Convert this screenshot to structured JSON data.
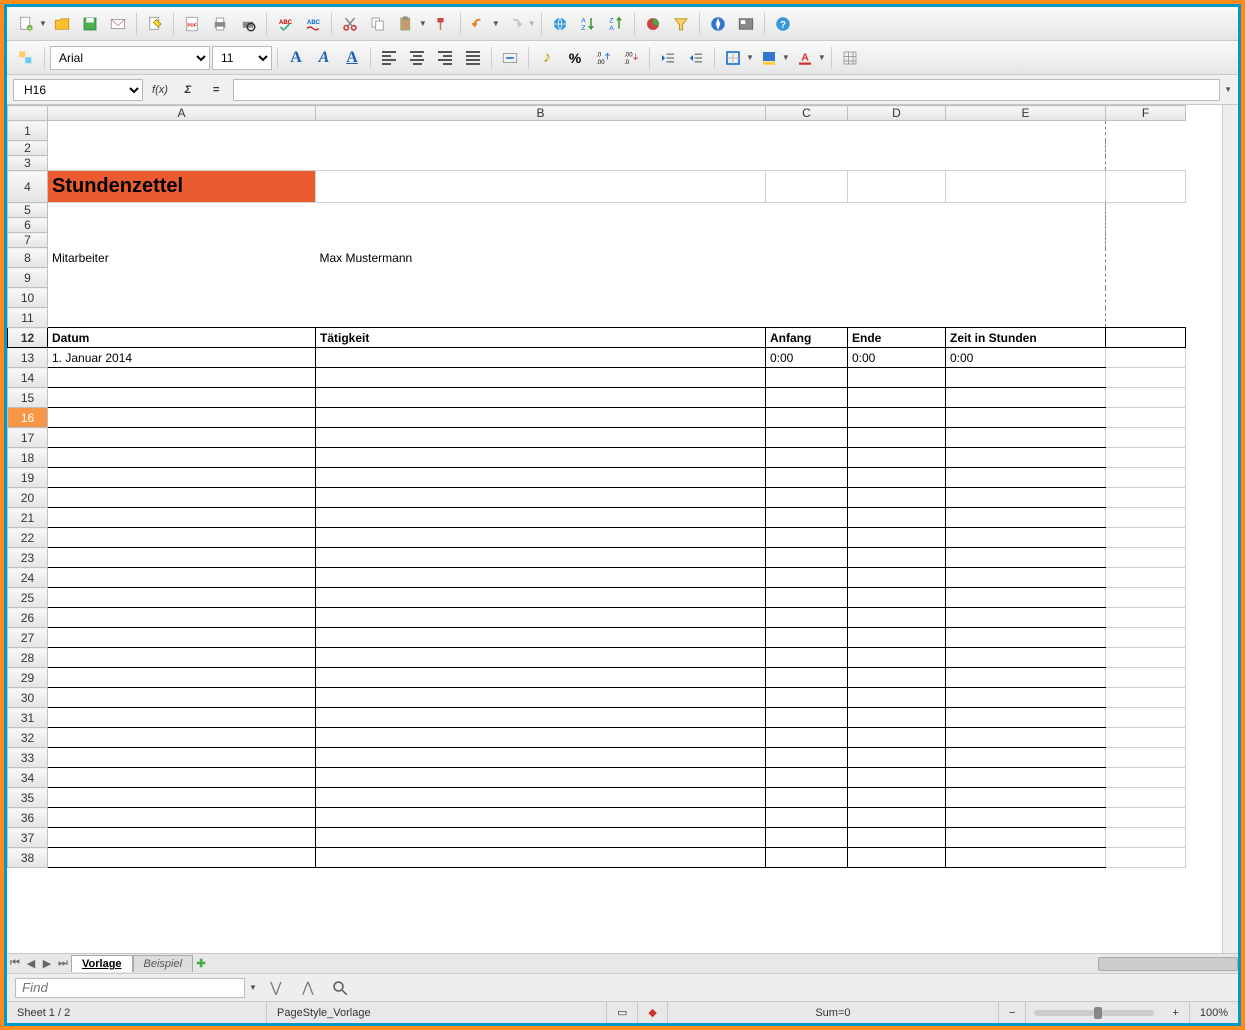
{
  "toolbar1": {
    "icons": [
      "new-document",
      "open-document",
      "save-document",
      "email-document",
      "edit-document",
      "pdf-export",
      "print",
      "print-preview",
      "spellcheck",
      "autospellcheck",
      "cut",
      "copy",
      "paste",
      "format-paintbrush",
      "undo",
      "redo",
      "hyperlink",
      "sort-asc",
      "sort-desc",
      "chart-insert",
      "filter",
      "navigator",
      "gallery",
      "help"
    ]
  },
  "toolbar2": {
    "styles_icon": "styles-icon",
    "font_name": "Arial",
    "font_size": "11",
    "bold": "A",
    "italic": "A",
    "underline": "A",
    "merge_label": "⬍",
    "currency": "%",
    "number_fmt": ".0"
  },
  "formula_bar": {
    "cell_ref": "H16",
    "fx": "f(x)",
    "sigma": "Σ",
    "eq": "=",
    "value": ""
  },
  "columns": [
    "A",
    "B",
    "C",
    "D",
    "E",
    "F"
  ],
  "sheet": {
    "title": "Stundenzettel",
    "employee_label": "Mitarbeiter",
    "employee_name": "Max Mustermann",
    "headers": [
      "Datum",
      "Tätigkeit",
      "Anfang",
      "Ende",
      "Zeit in Stunden"
    ],
    "first_row": [
      "1. Januar 2014",
      "",
      "0:00",
      "0:00",
      "0:00"
    ]
  },
  "row_nums": [
    1,
    2,
    3,
    4,
    5,
    6,
    7,
    8,
    9,
    10,
    11,
    12,
    13,
    14,
    15,
    16,
    17,
    18,
    19,
    20,
    21,
    22,
    23,
    24,
    25,
    26,
    27,
    28,
    29,
    30,
    31,
    32,
    33,
    34,
    35,
    36,
    37,
    38
  ],
  "selected_row": 16,
  "tabs": {
    "active": "Vorlage",
    "inactive": "Beispiel"
  },
  "find": {
    "placeholder": "Find"
  },
  "status": {
    "sheet": "Sheet 1 / 2",
    "pagestyle": "PageStyle_Vorlage",
    "sum": "Sum=0",
    "zoom": "100%"
  }
}
